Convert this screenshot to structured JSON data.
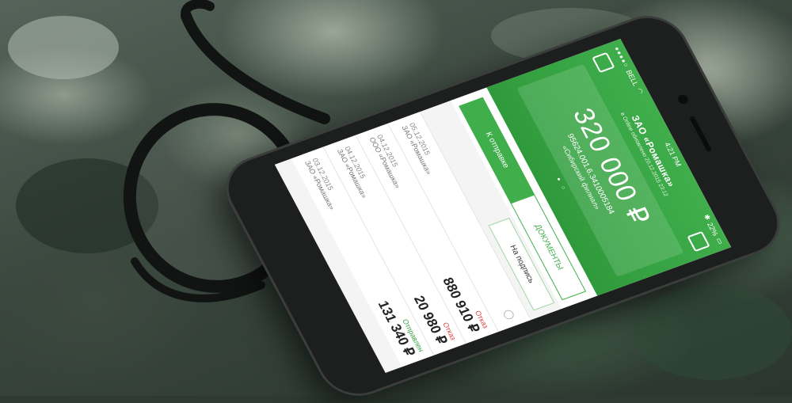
{
  "statusbar": {
    "carrier": "BELL",
    "time": "4:21 PM",
    "battery": "22%"
  },
  "header": {
    "company": "ЗАО «Ромашка»",
    "status": "в Online обновлено 20.12.2015 23:12"
  },
  "account_card": {
    "balance": "320 000 ₽",
    "account_number": "95624.001.6.3410005184",
    "branch": "«Сибирский филиал»"
  },
  "tabs": [
    {
      "label": "К отправке"
    },
    {
      "label": "ДОКУМЕНТЫ"
    }
  ],
  "sign_button": "На подпись",
  "documents": [
    {
      "date": "05.12.2015",
      "name": "ЗАО «Ромашка»",
      "amount": "",
      "status": ""
    },
    {
      "date": "04.12.2015",
      "name": "ООО «Ромашка»",
      "amount": "880 910 ₽",
      "status": "Отказ",
      "status_ok": false
    },
    {
      "date": "04.12.2015",
      "name": "ЗАО «Ромашка»",
      "amount": "20 980 ₽",
      "status": "Отказ",
      "status_ok": false
    },
    {
      "date": "03.12.2015",
      "name": "ЗАО «Ромашка»",
      "amount": "131 340 ₽",
      "status": "Отправлен",
      "status_ok": true
    }
  ],
  "icons": {
    "menu": "menu-icon",
    "logout": "logout-icon",
    "bluetooth": "bluetooth-icon",
    "wifi": "wifi-icon",
    "battery": "battery-icon"
  },
  "colors": {
    "accent": "#3fae4b",
    "refused": "#e0413c"
  }
}
